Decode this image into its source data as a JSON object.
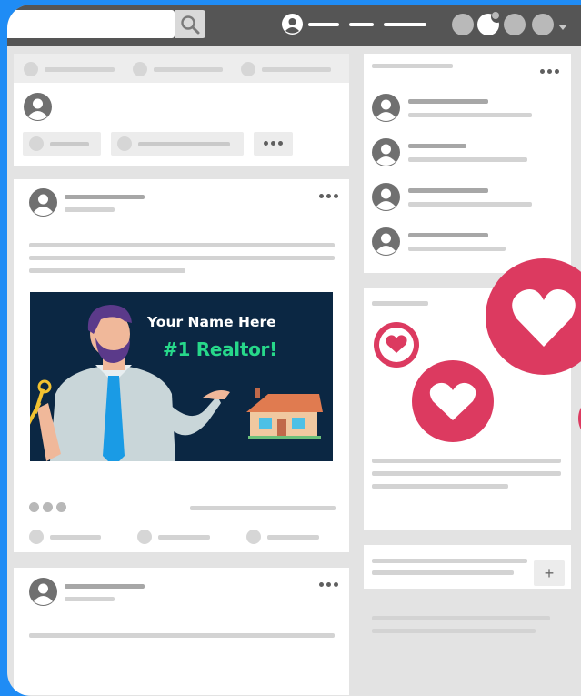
{
  "banner": {
    "name_text": "Your Name Here",
    "title_text": "#1 Realtor!"
  },
  "icons": {
    "search": "search-icon",
    "user": "user-icon",
    "more": "more-dots-icon",
    "heart": "heart-icon",
    "plus": "+",
    "house": "house-icon",
    "keys": "keys-icon"
  },
  "colors": {
    "frame_border": "#1f8cf5",
    "topbar": "#555555",
    "heart_red": "#dc3a60",
    "banner_bg": "#0b2743",
    "banner_accent": "#27d88a"
  }
}
